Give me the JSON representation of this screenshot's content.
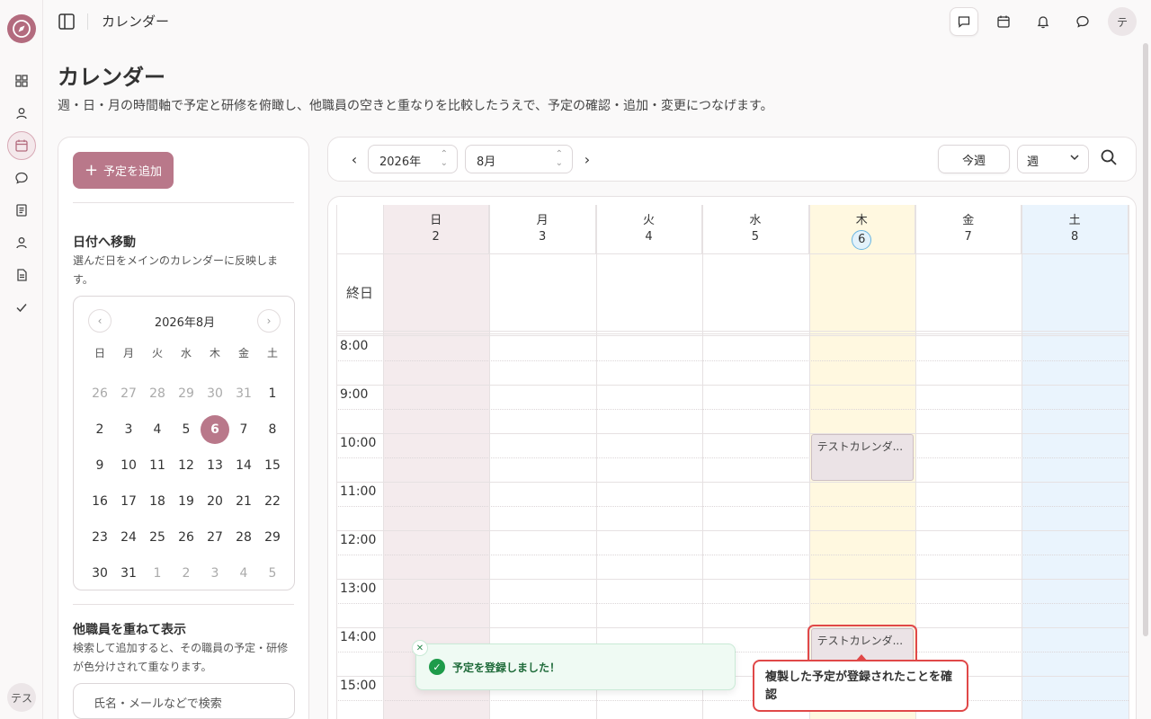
{
  "app": {
    "title": "カレンダー",
    "user_initial": "テ",
    "rail_user": "テス"
  },
  "header": {
    "title": "カレンダー",
    "description": "週・日・月の時間軸で予定と研修を俯瞰し、他職員の空きと重なりを比較したうえで、予定の確認・追加・変更につなげます。"
  },
  "top_icons": [
    "message-square-icon",
    "calendar-icon",
    "bell-icon",
    "chat-bubble-icon"
  ],
  "rail_icons": [
    "dashboard-icon",
    "user-icon",
    "calendar-icon",
    "chat-icon",
    "notebook-icon",
    "user-icon",
    "document-icon",
    "check-icon"
  ],
  "left": {
    "add_label": "予定を追加",
    "goto_title": "日付へ移動",
    "goto_desc": "選んだ日をメインのカレンダーに反映します。",
    "mini_title": "2026年8月",
    "weekdays": [
      "日",
      "月",
      "火",
      "水",
      "木",
      "金",
      "土"
    ],
    "selected_day": "6",
    "overlay_title": "他職員を重ねて表示",
    "overlay_desc": "検索して追加すると、その職員の予定・研修が色分けされて重なります。",
    "search_placeholder": "氏名・メールなどで検索"
  },
  "toolbar": {
    "year": "2026年",
    "month": "8月",
    "today": "今週",
    "view": "週"
  },
  "calendar": {
    "days": [
      {
        "name": "日",
        "date": "2"
      },
      {
        "name": "月",
        "date": "3"
      },
      {
        "name": "火",
        "date": "4"
      },
      {
        "name": "水",
        "date": "5"
      },
      {
        "name": "木",
        "date": "6"
      },
      {
        "name": "金",
        "date": "7"
      },
      {
        "name": "土",
        "date": "8"
      }
    ],
    "today_date": "6",
    "allday_label": "終日",
    "times": [
      "8:00",
      "9:00",
      "10:00",
      "11:00",
      "12:00",
      "13:00",
      "14:00",
      "15:00"
    ],
    "events": [
      {
        "title": "テストカレンダ...",
        "day": "木",
        "start": "10:00",
        "end": "11:00"
      },
      {
        "title": "テストカレンダ...",
        "day": "木",
        "start": "14:00",
        "end": "15:00"
      }
    ],
    "colors": {
      "sunday": "#f4ebed",
      "today": "#fff8e0",
      "saturday": "#eaf4fd"
    }
  },
  "toast": {
    "message": "予定を登録しました！"
  },
  "callout": {
    "text": "複製した予定が登録されたことを確認"
  }
}
